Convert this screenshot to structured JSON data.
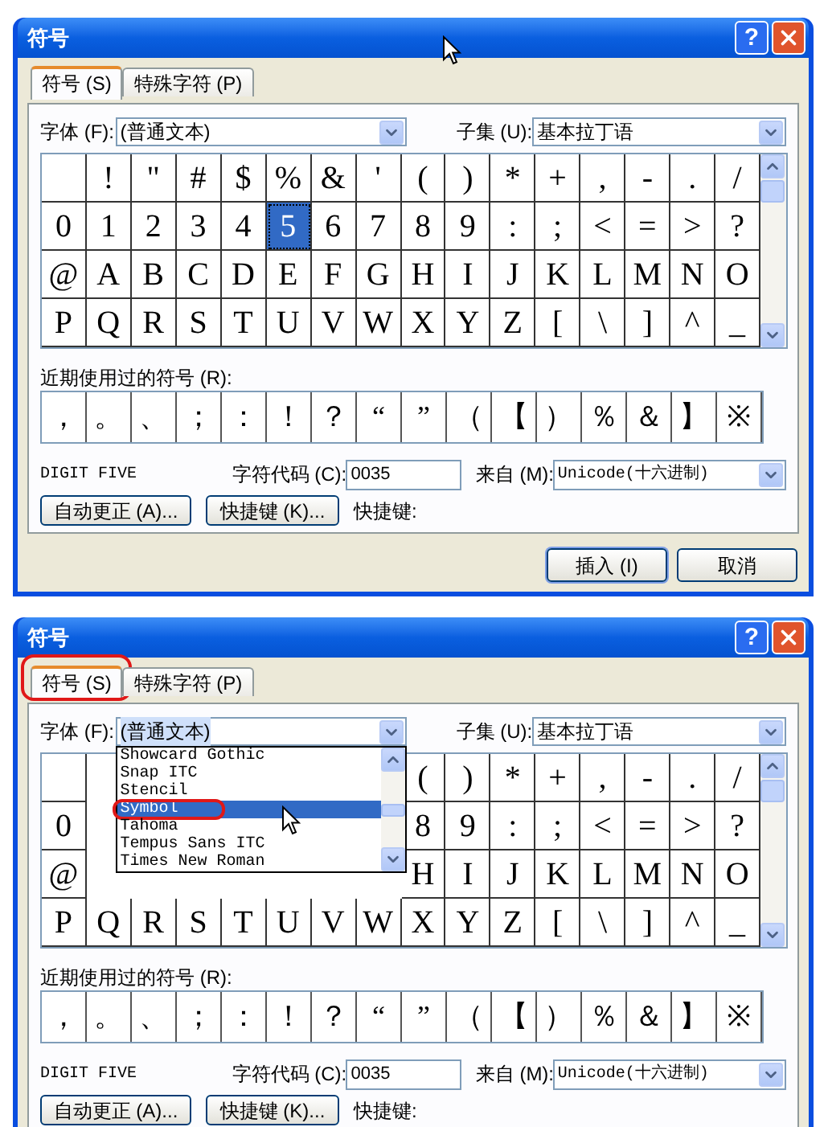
{
  "dialogs": [
    {
      "title": "符号",
      "help_button": "?",
      "tabs": [
        {
          "label": "符号 (S)",
          "selected": true,
          "annotated": false
        },
        {
          "label": "特殊字符 (P)",
          "selected": false,
          "annotated": false
        }
      ],
      "font": {
        "label": "字体 (F):",
        "value": "(普通文本)",
        "open": false
      },
      "subset": {
        "label": "子集 (U):",
        "value": "基本拉丁语"
      },
      "grid": [
        [
          {
            "selected": false
          },
          {
            "char": "!",
            "selected": false
          },
          {
            "char": "\"",
            "selected": false
          },
          {
            "char": "#",
            "selected": false
          },
          {
            "char": "$",
            "selected": false
          },
          {
            "char": "%",
            "selected": false
          },
          {
            "char": "&",
            "selected": false
          },
          {
            "char": "'",
            "selected": false
          },
          {
            "char": "(",
            "selected": false
          },
          {
            "char": ")",
            "selected": false
          },
          {
            "char": "*",
            "selected": false
          },
          {
            "char": "+",
            "selected": false
          },
          {
            "char": ",",
            "selected": false
          },
          {
            "char": "-",
            "selected": false
          },
          {
            "char": ".",
            "selected": false
          },
          {
            "char": "/",
            "selected": false
          }
        ],
        [
          {
            "char": "0",
            "selected": false
          },
          {
            "char": "1",
            "selected": false
          },
          {
            "char": "2",
            "selected": false
          },
          {
            "char": "3",
            "selected": false
          },
          {
            "char": "4",
            "selected": false
          },
          {
            "char": "5",
            "selected": true
          },
          {
            "char": "6",
            "selected": false
          },
          {
            "char": "7",
            "selected": false
          },
          {
            "char": "8",
            "selected": false
          },
          {
            "char": "9",
            "selected": false
          },
          {
            "char": ":",
            "selected": false
          },
          {
            "char": ";",
            "selected": false
          },
          {
            "char": "<",
            "selected": false
          },
          {
            "char": "=",
            "selected": false
          },
          {
            "char": ">",
            "selected": false
          },
          {
            "char": "?",
            "selected": false
          }
        ],
        [
          {
            "char": "@",
            "selected": false
          },
          {
            "char": "A",
            "selected": false
          },
          {
            "char": "B",
            "selected": false
          },
          {
            "char": "C",
            "selected": false
          },
          {
            "char": "D",
            "selected": false
          },
          {
            "char": "E",
            "selected": false
          },
          {
            "char": "F",
            "selected": false
          },
          {
            "char": "G",
            "selected": false
          },
          {
            "char": "H",
            "selected": false
          },
          {
            "char": "I",
            "selected": false
          },
          {
            "char": "J",
            "selected": false
          },
          {
            "char": "K",
            "selected": false
          },
          {
            "char": "L",
            "selected": false
          },
          {
            "char": "M",
            "selected": false
          },
          {
            "char": "N",
            "selected": false
          },
          {
            "char": "O",
            "selected": false
          }
        ],
        [
          {
            "char": "P",
            "selected": false
          },
          {
            "char": "Q",
            "selected": false
          },
          {
            "char": "R",
            "selected": false
          },
          {
            "char": "S",
            "selected": false
          },
          {
            "char": "T",
            "selected": false
          },
          {
            "char": "U",
            "selected": false
          },
          {
            "char": "V",
            "selected": false
          },
          {
            "char": "W",
            "selected": false
          },
          {
            "char": "X",
            "selected": false
          },
          {
            "char": "Y",
            "selected": false
          },
          {
            "char": "Z",
            "selected": false
          },
          {
            "char": "[",
            "selected": false
          },
          {
            "char": "\\",
            "selected": false
          },
          {
            "char": "]",
            "selected": false
          },
          {
            "char": "^",
            "selected": false
          },
          {
            "char": "_",
            "selected": false
          }
        ]
      ],
      "recent_label": "近期使用过的符号 (R):",
      "recent": [
        "，",
        "。",
        "、",
        "；",
        "：",
        "！",
        "？",
        "“",
        "”",
        "（",
        "【",
        "）",
        "％",
        "＆",
        "】",
        "※"
      ],
      "char_name": "DIGIT FIVE",
      "char_code": {
        "label": "字符代码 (C):",
        "value": "0035"
      },
      "from": {
        "label": "来自 (M):",
        "value": "Unicode(十六进制)"
      },
      "actions": [
        "自动更正 (A)...",
        "快捷键 (K)..."
      ],
      "shortcut_label": "快捷键:",
      "buttons": [
        {
          "label": "插入 (I)",
          "default": true
        },
        {
          "label": "取消",
          "default": false
        }
      ]
    },
    {
      "title": "符号",
      "help_button": "?",
      "tabs": [
        {
          "label": "符号 (S)",
          "selected": true,
          "annotated": true
        },
        {
          "label": "特殊字符 (P)",
          "selected": false
        }
      ],
      "font": {
        "label": "字体 (F):",
        "value": "(普通文本)",
        "open": true,
        "options": [
          {
            "label": "Showcard Gothic",
            "selected": false,
            "annotated": false
          },
          {
            "label": "Snap ITC",
            "selected": false,
            "annotated": false
          },
          {
            "label": "Stencil",
            "selected": false,
            "annotated": false
          },
          {
            "label": "Symbol",
            "selected": true,
            "annotated": true
          },
          {
            "label": "Tahoma",
            "selected": false,
            "annotated": false
          },
          {
            "label": "Tempus Sans ITC",
            "selected": false,
            "annotated": false
          },
          {
            "label": "Times New Roman",
            "selected": false,
            "annotated": false
          }
        ]
      },
      "subset": {
        "label": "子集 (U):",
        "value": "基本拉丁语"
      },
      "grid": [
        [
          {
            "kind": "glyph",
            "selected": false
          },
          {
            "kind": "covered"
          },
          {
            "kind": "covered"
          },
          {
            "kind": "covered"
          },
          {
            "kind": "covered"
          },
          {
            "kind": "covered"
          },
          {
            "kind": "covered"
          },
          {
            "kind": "covered"
          },
          {
            "kind": "glyph",
            "char": "(",
            "selected": false
          },
          {
            "kind": "glyph",
            "char": ")",
            "selected": false
          },
          {
            "kind": "glyph",
            "char": "*",
            "selected": false
          },
          {
            "kind": "glyph",
            "char": "+",
            "selected": false
          },
          {
            "kind": "glyph",
            "char": ",",
            "selected": false
          },
          {
            "kind": "glyph",
            "char": "-",
            "selected": false
          },
          {
            "kind": "glyph",
            "char": ".",
            "selected": false
          },
          {
            "kind": "glyph",
            "char": "/",
            "selected": false
          }
        ],
        [
          {
            "kind": "glyph",
            "char": "0",
            "selected": false
          },
          {
            "kind": "covered"
          },
          {
            "kind": "covered"
          },
          {
            "kind": "covered"
          },
          {
            "kind": "covered"
          },
          {
            "kind": "covered"
          },
          {
            "kind": "covered"
          },
          {
            "kind": "covered"
          },
          {
            "kind": "glyph",
            "char": "8",
            "selected": false
          },
          {
            "kind": "glyph",
            "char": "9",
            "selected": false
          },
          {
            "kind": "glyph",
            "char": ":",
            "selected": false
          },
          {
            "kind": "glyph",
            "char": ";",
            "selected": false
          },
          {
            "kind": "glyph",
            "char": "<",
            "selected": false
          },
          {
            "kind": "glyph",
            "char": "=",
            "selected": false
          },
          {
            "kind": "glyph",
            "char": ">",
            "selected": false
          },
          {
            "kind": "glyph",
            "char": "?",
            "selected": false
          }
        ],
        [
          {
            "kind": "glyph",
            "char": "@",
            "selected": false
          },
          {
            "kind": "covered"
          },
          {
            "kind": "covered"
          },
          {
            "kind": "covered"
          },
          {
            "kind": "covered"
          },
          {
            "kind": "covered"
          },
          {
            "kind": "covered"
          },
          {
            "kind": "covered"
          },
          {
            "kind": "glyph",
            "char": "H",
            "selected": false
          },
          {
            "kind": "glyph",
            "char": "I",
            "selected": false
          },
          {
            "kind": "glyph",
            "char": "J",
            "selected": false
          },
          {
            "kind": "glyph",
            "char": "K",
            "selected": false
          },
          {
            "kind": "glyph",
            "char": "L",
            "selected": false
          },
          {
            "kind": "glyph",
            "char": "M",
            "selected": false
          },
          {
            "kind": "glyph",
            "char": "N",
            "selected": false
          },
          {
            "kind": "glyph",
            "char": "O",
            "selected": false
          }
        ],
        [
          {
            "char": "P",
            "selected": false
          },
          {
            "char": "Q",
            "selected": false
          },
          {
            "char": "R",
            "selected": false
          },
          {
            "char": "S",
            "selected": false
          },
          {
            "char": "T",
            "selected": false
          },
          {
            "char": "U",
            "selected": false
          },
          {
            "char": "V",
            "selected": false
          },
          {
            "char": "W",
            "selected": false
          },
          {
            "char": "X",
            "selected": false
          },
          {
            "char": "Y",
            "selected": false
          },
          {
            "char": "Z",
            "selected": false
          },
          {
            "char": "[",
            "selected": false
          },
          {
            "char": "\\",
            "selected": false
          },
          {
            "char": "]",
            "selected": false
          },
          {
            "char": "^",
            "selected": false
          },
          {
            "char": "_",
            "selected": false
          }
        ]
      ],
      "recent_label": "近期使用过的符号 (R):",
      "recent": [
        "，",
        "。",
        "、",
        "；",
        "：",
        "！",
        "？",
        "“",
        "”",
        "（",
        "【",
        "）",
        "％",
        "＆",
        "】",
        "※"
      ],
      "char_name": "DIGIT FIVE",
      "char_code": {
        "label": "字符代码 (C):",
        "value": "0035"
      },
      "from": {
        "label": "来自 (M):",
        "value": "Unicode(十六进制)"
      },
      "actions": [
        "自动更正 (A)...",
        "快捷键 (K)..."
      ],
      "shortcut_label": "快捷键:"
    }
  ]
}
